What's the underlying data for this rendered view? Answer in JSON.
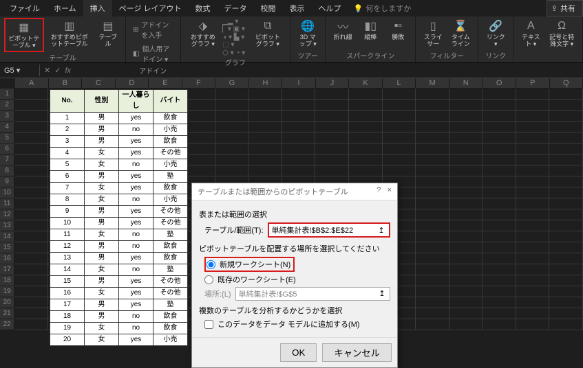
{
  "tabs": {
    "file": "ファイル",
    "home": "ホーム",
    "insert": "挿入",
    "page_layout": "ページ レイアウト",
    "formulas": "数式",
    "data": "データ",
    "review": "校閲",
    "view": "表示",
    "help": "ヘルプ",
    "tell_me": "何をしますか"
  },
  "share": "共有",
  "ribbon": {
    "pivot_table": "ピボットテーブル ▾",
    "recommended_pivot": "おすすめピボットテーブル",
    "table": "テーブル",
    "group_tables": "テーブル",
    "addins_store": "アドインを入手",
    "addins_mine": "個人用アドイン ▾",
    "group_addins": "アドイン",
    "recommended_chart": "おすすめグラフ ▾",
    "pivot_chart": "ピボットグラフ ▾",
    "group_charts": "グラフ",
    "map3d": "3D マップ ▾",
    "group_tours": "ツアー",
    "sparkline_line": "折れ線",
    "sparkline_col": "縦棒",
    "sparkline_wl": "勝敗",
    "group_spark": "スパークライン",
    "slicer": "スライサー",
    "timeline": "タイムライン",
    "group_filter": "フィルター",
    "link": "リンク ▾",
    "group_link": "リンク",
    "text": "テキスト ▾",
    "symbols": "記号と特殊文字 ▾"
  },
  "name_box": "G5",
  "columns": [
    "A",
    "B",
    "C",
    "D",
    "E",
    "F",
    "G",
    "H",
    "I",
    "J",
    "K",
    "L",
    "M",
    "N",
    "O",
    "P",
    "Q"
  ],
  "row_count": 22,
  "table": {
    "headers": [
      "No.",
      "性別",
      "一人暮らし",
      "バイト"
    ],
    "rows": [
      [
        "1",
        "男",
        "yes",
        "飲食"
      ],
      [
        "2",
        "男",
        "no",
        "小売"
      ],
      [
        "3",
        "男",
        "yes",
        "飲食"
      ],
      [
        "4",
        "女",
        "yes",
        "その他"
      ],
      [
        "5",
        "女",
        "no",
        "小売"
      ],
      [
        "6",
        "男",
        "yes",
        "塾"
      ],
      [
        "7",
        "女",
        "yes",
        "飲食"
      ],
      [
        "8",
        "女",
        "no",
        "小売"
      ],
      [
        "9",
        "男",
        "yes",
        "その他"
      ],
      [
        "10",
        "男",
        "yes",
        "その他"
      ],
      [
        "11",
        "女",
        "no",
        "塾"
      ],
      [
        "12",
        "男",
        "no",
        "飲食"
      ],
      [
        "13",
        "男",
        "yes",
        "飲食"
      ],
      [
        "14",
        "女",
        "no",
        "塾"
      ],
      [
        "15",
        "男",
        "yes",
        "その他"
      ],
      [
        "16",
        "女",
        "yes",
        "その他"
      ],
      [
        "17",
        "男",
        "yes",
        "塾"
      ],
      [
        "18",
        "男",
        "no",
        "飲食"
      ],
      [
        "19",
        "女",
        "no",
        "飲食"
      ],
      [
        "20",
        "女",
        "yes",
        "小売"
      ]
    ]
  },
  "dialog": {
    "title": "テーブルまたは範囲からのピボットテーブル",
    "help": "?",
    "close": "×",
    "section_range": "表または範囲の選択",
    "range_label": "テーブル/範囲(T):",
    "range_value": "単純集計表!$B$2:$E$22",
    "section_placement": "ピボットテーブルを配置する場所を選択してください",
    "radio_new": "新規ワークシート(N)",
    "radio_existing": "既存のワークシート(E)",
    "location_label": "場所:(L)",
    "location_value": "単純集計表!$G$5",
    "section_multi": "複数のテーブルを分析するかどうかを選択",
    "check_model": "このデータをデータ モデルに追加する(M)",
    "ok": "OK",
    "cancel": "キャンセル"
  }
}
